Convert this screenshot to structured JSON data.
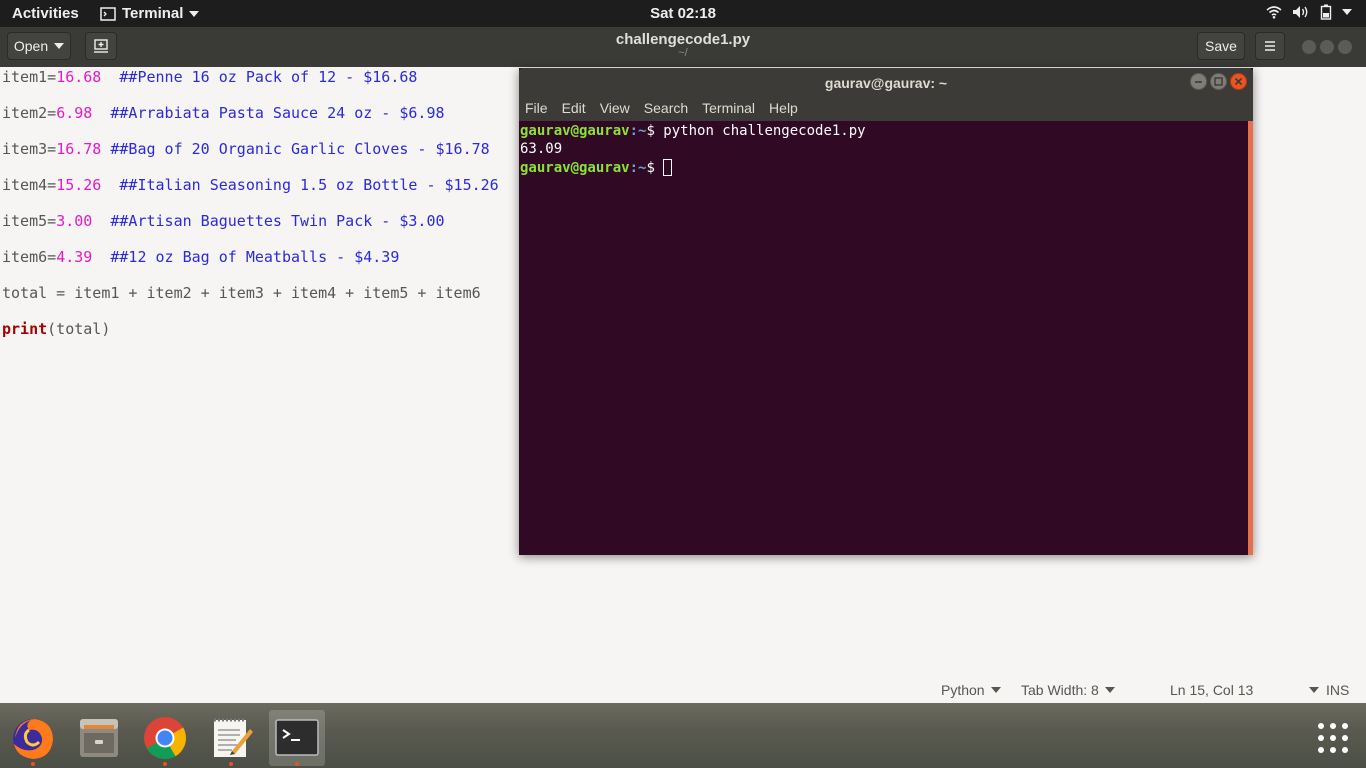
{
  "topbar": {
    "activities": "Activities",
    "app_name": "Terminal",
    "clock": "Sat 02:18"
  },
  "gedit": {
    "open_label": "Open",
    "title": "challengecode1.py",
    "subtitle": "~/",
    "save_label": "Save"
  },
  "editor": {
    "lines": [
      {
        "var": "item1=",
        "num": "16.68",
        "gap": "  ",
        "comment": "##Penne 16 oz Pack of 12 - $16.68"
      },
      {
        "var": "item2=",
        "num": "6.98",
        "gap": "  ",
        "comment": "##Arrabiata Pasta Sauce 24 oz - $6.98"
      },
      {
        "var": "item3=",
        "num": "16.78",
        "gap": " ",
        "comment": "##Bag of 20 Organic Garlic Cloves - $16.78"
      },
      {
        "var": "item4=",
        "num": "15.26",
        "gap": "  ",
        "comment": "##Italian Seasoning 1.5 oz Bottle - $15.26"
      },
      {
        "var": "item5=",
        "num": "3.00",
        "gap": "  ",
        "comment": "##Artisan Baguettes Twin Pack - $3.00"
      },
      {
        "var": "item6=",
        "num": "4.39",
        "gap": "  ",
        "comment": "##12 oz Bag of Meatballs - $4.39"
      }
    ],
    "total_line": "total = item1 + item2 + item3 + item4 + item5 + item6",
    "print_kw": "print",
    "print_args": "(total)"
  },
  "statusbar": {
    "language": "Python",
    "tab_width": "Tab Width: 8",
    "position": "Ln 15, Col 13",
    "mode": "INS"
  },
  "terminal": {
    "title": "gaurav@gaurav: ~",
    "menu": [
      "File",
      "Edit",
      "View",
      "Search",
      "Terminal",
      "Help"
    ],
    "prompt_user": "gaurav@gaurav",
    "prompt_path": ":~",
    "prompt_sym": "$ ",
    "command": "python challengecode1.py",
    "output": "63.09"
  },
  "dock": {
    "icons": [
      "firefox-icon",
      "files-icon",
      "chrome-icon",
      "text-editor-icon",
      "terminal-icon",
      "show-applications-icon"
    ]
  },
  "colors": {
    "terminal_bg": "#300a24",
    "accent": "#e95420",
    "number": "#e11ac9",
    "comment": "#2a2ad8"
  }
}
